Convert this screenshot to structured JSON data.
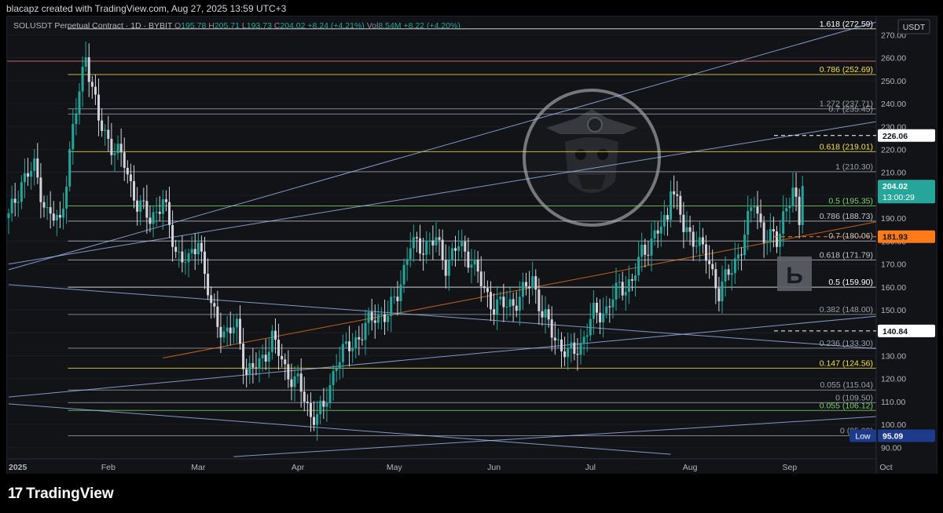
{
  "header": {
    "text": "blacapz created with TradingView.com, Aug 27, 2025 13:59 UTC+3"
  },
  "legend": {
    "symbol": "SOLUSDT Perpetual Contract · 1D · BYBIT",
    "o_label": "O",
    "o": "195.78",
    "h_label": "H",
    "h": "205.71",
    "l_label": "L",
    "l": "193.73",
    "c_label": "C",
    "c": "204.02",
    "change": "+8.24 (+4.21%)",
    "vol_label": "Vol",
    "vol": "8.54M",
    "vol_change": "+8.22 (+4.20%)"
  },
  "currency": "USDT",
  "footer": {
    "logo_mark": "17",
    "brand": "TradingView"
  },
  "watermark": {
    "icon": "skull-bitcoin-pirate-icon"
  },
  "badge": {
    "icon": "tb-logo-icon",
    "text": "Ь"
  },
  "colors": {
    "up": "#26a69a",
    "down": "#d1d4dc",
    "bg": "#121317",
    "yellow": "#f5e14a",
    "orange": "#ff7a1a",
    "blue": "#a7c3ff"
  },
  "chart_data": {
    "type": "candlestick",
    "y_range": [
      85,
      278
    ],
    "y_ticks": [
      90,
      100,
      110,
      120,
      130,
      140,
      150,
      160,
      170,
      180,
      190,
      200,
      210,
      220,
      230,
      240,
      250,
      260,
      270
    ],
    "x_labels": [
      {
        "text": "2025",
        "day": 0
      },
      {
        "text": "Feb",
        "day": 31
      },
      {
        "text": "Mar",
        "day": 59
      },
      {
        "text": "Apr",
        "day": 90
      },
      {
        "text": "May",
        "day": 120
      },
      {
        "text": "Jun",
        "day": 151
      },
      {
        "text": "Jul",
        "day": 181
      },
      {
        "text": "Aug",
        "day": 212
      },
      {
        "text": "Sep",
        "day": 243
      },
      {
        "text": "Oct",
        "day": 273
      }
    ],
    "anchors": [
      [
        0,
        190
      ],
      [
        4,
        206
      ],
      [
        8,
        212
      ],
      [
        12,
        192
      ],
      [
        16,
        188
      ],
      [
        20,
        228
      ],
      [
        24,
        262
      ],
      [
        28,
        232
      ],
      [
        32,
        222
      ],
      [
        36,
        214
      ],
      [
        40,
        196
      ],
      [
        44,
        190
      ],
      [
        48,
        197
      ],
      [
        52,
        176
      ],
      [
        56,
        170
      ],
      [
        59,
        182
      ],
      [
        63,
        150
      ],
      [
        67,
        140
      ],
      [
        71,
        142
      ],
      [
        74,
        123
      ],
      [
        78,
        126
      ],
      [
        82,
        138
      ],
      [
        86,
        124
      ],
      [
        90,
        118
      ],
      [
        94,
        104
      ],
      [
        98,
        106
      ],
      [
        102,
        128
      ],
      [
        106,
        134
      ],
      [
        110,
        140
      ],
      [
        114,
        148
      ],
      [
        118,
        147
      ],
      [
        121,
        158
      ],
      [
        125,
        178
      ],
      [
        129,
        178
      ],
      [
        133,
        180
      ],
      [
        136,
        170
      ],
      [
        140,
        178
      ],
      [
        144,
        172
      ],
      [
        148,
        158
      ],
      [
        151,
        152
      ],
      [
        155,
        152
      ],
      [
        159,
        155
      ],
      [
        163,
        164
      ],
      [
        166,
        148
      ],
      [
        170,
        138
      ],
      [
        174,
        130
      ],
      [
        178,
        135
      ],
      [
        182,
        148
      ],
      [
        186,
        150
      ],
      [
        190,
        160
      ],
      [
        194,
        162
      ],
      [
        197,
        175
      ],
      [
        201,
        182
      ],
      [
        205,
        190
      ],
      [
        206,
        207
      ],
      [
        210,
        185
      ],
      [
        214,
        181
      ],
      [
        218,
        170
      ],
      [
        221,
        158
      ],
      [
        225,
        168
      ],
      [
        228,
        178
      ],
      [
        232,
        198
      ],
      [
        235,
        182
      ],
      [
        239,
        180
      ],
      [
        241,
        192
      ],
      [
        244,
        201
      ],
      [
        246,
        188
      ],
      [
        247,
        204.02
      ]
    ],
    "levels": [
      {
        "price": 272.59,
        "text": "1.618 (272.59)",
        "color": "#ffffff",
        "x0": 0.07,
        "style": "solid"
      },
      {
        "price": 258.5,
        "text": "",
        "color": "#f08080",
        "x0": 0.0,
        "style": "solid"
      },
      {
        "price": 252.69,
        "text": "0.786 (252.69)",
        "color": "#f5e14a",
        "x0": 0.07,
        "style": "solid"
      },
      {
        "price": 237.71,
        "text": "1.272 (237.71)",
        "color": "#9aa0aa",
        "x0": 0.07,
        "style": "solid"
      },
      {
        "price": 235.45,
        "text": "0.7 (235.45)",
        "color": "#9aa0aa",
        "x0": 0.07,
        "style": "solid"
      },
      {
        "price": 219.01,
        "text": "0.618 (219.01)",
        "color": "#f5e14a",
        "x0": 0.07,
        "style": "solid"
      },
      {
        "price": 210.3,
        "text": "1 (210.30)",
        "color": "#9aa0aa",
        "x0": 0.07,
        "style": "solid"
      },
      {
        "price": 195.35,
        "text": "0.5 (195.35)",
        "color": "#7bd36b",
        "x0": 0.07,
        "style": "solid"
      },
      {
        "price": 188.73,
        "text": "0.786 (188.73)",
        "color": "#c0c4cc",
        "x0": 0.07,
        "style": "solid"
      },
      {
        "price": 180.06,
        "text": "0.7 (180.06)",
        "color": "#c0c4cc",
        "x0": 0.07,
        "style": "solid"
      },
      {
        "price": 171.79,
        "text": "0.618 (171.79)",
        "color": "#c0c4cc",
        "x0": 0.07,
        "style": "solid"
      },
      {
        "price": 159.9,
        "text": "0.5 (159.90)",
        "color": "#ffffff",
        "x0": 0.07,
        "style": "solid"
      },
      {
        "price": 148.0,
        "text": "0.382 (148.00)",
        "color": "#9aa0aa",
        "x0": 0.07,
        "style": "solid"
      },
      {
        "price": 133.3,
        "text": "0.236 (133.30)",
        "color": "#9aa0aa",
        "x0": 0.07,
        "style": "solid"
      },
      {
        "price": 124.56,
        "text": "0.147 (124.56)",
        "color": "#f5e14a",
        "x0": 0.07,
        "style": "solid"
      },
      {
        "price": 115.04,
        "text": "0.055 (115.04)",
        "color": "#9aa0aa",
        "x0": 0.07,
        "style": "solid"
      },
      {
        "price": 109.5,
        "text": "0 (109.50)",
        "color": "#9aa0aa",
        "x0": 0.07,
        "style": "solid"
      },
      {
        "price": 106.12,
        "text": "0.055 (106.12)",
        "color": "#7bd36b",
        "x0": 0.07,
        "style": "solid"
      },
      {
        "price": 95.09,
        "text": "0 (95.09)",
        "color": "#9aa0aa",
        "x0": 0.07,
        "style": "solid"
      }
    ],
    "trendlines": [
      {
        "from": [
          0,
          167.5
        ],
        "to": [
          276,
          278
        ],
        "color": "#a7c3ff"
      },
      {
        "from": [
          0,
          170
        ],
        "to": [
          276,
          233.5
        ],
        "color": "#a7c3ff"
      },
      {
        "from": [
          48,
          129
        ],
        "to": [
          276,
          190
        ],
        "color": "#ff7a1a"
      },
      {
        "from": [
          0,
          161
        ],
        "to": [
          276,
          132.5
        ],
        "color": "#a7c3ff"
      },
      {
        "from": [
          0,
          109
        ],
        "to": [
          206,
          87
        ],
        "color": "#a7c3ff"
      },
      {
        "from": [
          0,
          112
        ],
        "to": [
          276,
          148
        ],
        "color": "#a7c3ff"
      },
      {
        "from": [
          70,
          86
        ],
        "to": [
          276,
          104
        ],
        "color": "#a7c3ff"
      }
    ],
    "price_tags": [
      {
        "price": 226.06,
        "text": "226.06",
        "bg": "#ffffff",
        "fg": "#131722",
        "dashed": true
      },
      {
        "price": 204.02,
        "text": "204.02",
        "sub": "13:00:29",
        "bg": "#26a69a",
        "fg": "#ffffff",
        "dashed": false
      },
      {
        "price": 181.93,
        "text": "181.93",
        "bg": "#ff7a1a",
        "fg": "#131722",
        "dashed": true
      },
      {
        "price": 140.84,
        "text": "140.84",
        "bg": "#ffffff",
        "fg": "#131722",
        "dashed": true
      },
      {
        "price": 95.09,
        "text": "95.09",
        "label": "Low",
        "bg": "#1e3a8a",
        "fg": "#ffffff",
        "dashed": false
      }
    ]
  }
}
